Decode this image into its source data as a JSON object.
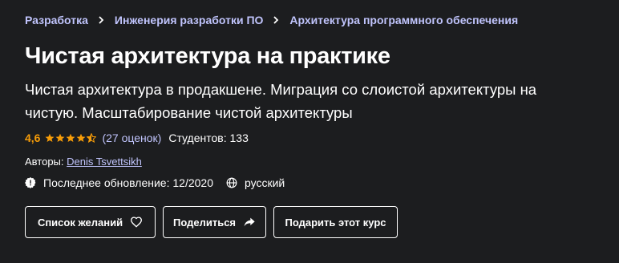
{
  "breadcrumb": {
    "items": [
      {
        "label": "Разработка"
      },
      {
        "label": "Инженерия разработки ПО"
      },
      {
        "label": "Архитектура программного обеспечения"
      }
    ]
  },
  "course": {
    "title": "Чистая архитектура на практике",
    "subtitle": "Чистая архитектура в продакшене. Миграция со слоистой архитектуры на чистую. Масштабирование чистой архитектуры",
    "rating": {
      "value": "4,6",
      "stars": 4.5,
      "count_text": "(27 оценок)"
    },
    "students_text": "Студентов: 133",
    "authors_label": "Авторы:",
    "author_name": "Denis Tsvettsikh",
    "last_updated_text": "Последнее обновление: 12/2020",
    "language": "русский"
  },
  "buttons": {
    "wishlist": "Список желаний",
    "share": "Поделиться",
    "gift": "Подарить этот курс"
  },
  "colors": {
    "background": "#1c1d1f",
    "link": "#c0c4fc",
    "rating": "#f69c08",
    "text": "#ffffff"
  },
  "icons": {
    "breadcrumb_separator": "chevron-right-icon",
    "rating_star": "star-icon",
    "last_updated": "alert-badge-icon",
    "language": "globe-icon",
    "wishlist": "heart-icon",
    "share": "share-arrow-icon"
  }
}
